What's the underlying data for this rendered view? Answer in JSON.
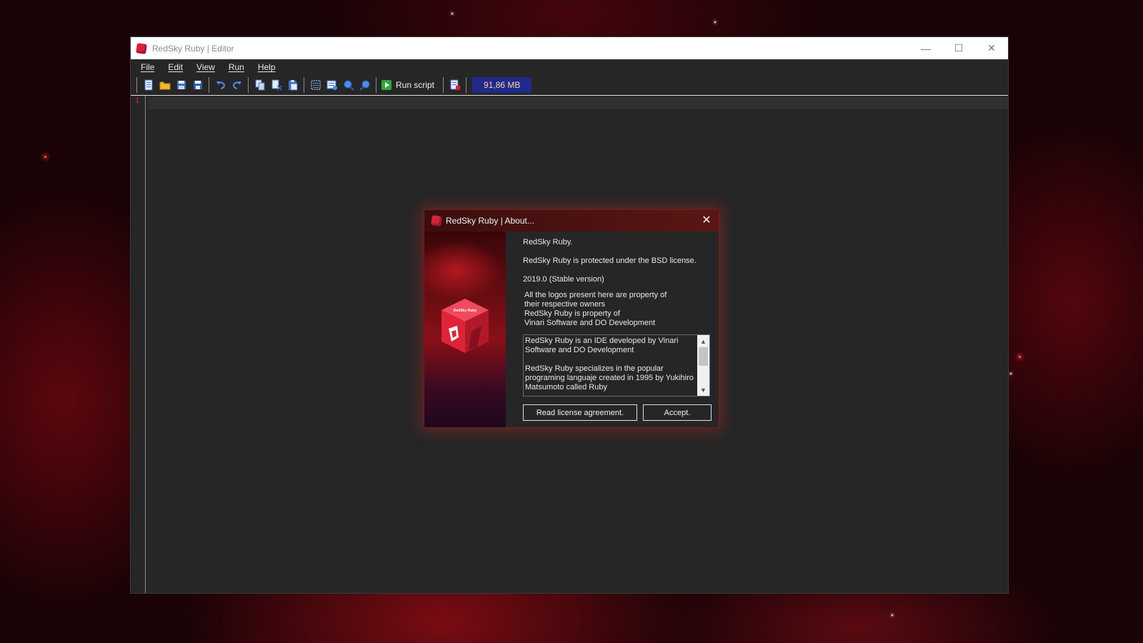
{
  "window": {
    "title": "RedSky Ruby | Editor",
    "controls": {
      "minimize": "—",
      "maximize": "☐",
      "close": "✕"
    }
  },
  "menu": {
    "items": [
      "File",
      "Edit",
      "View",
      "Run",
      "Help"
    ]
  },
  "toolbar": {
    "icons": [
      "new-file-icon",
      "open-folder-icon",
      "save-as-icon",
      "save-icon",
      "undo-icon",
      "redo-icon",
      "copy-icon",
      "cut-icon",
      "paste-icon",
      "select-all-icon",
      "find-icon",
      "zoom-in-icon",
      "zoom-out-icon",
      "run-icon",
      "script-settings-icon"
    ],
    "run_label": "Run script",
    "memory": "91,86 MB"
  },
  "editor": {
    "line_number": "1"
  },
  "about": {
    "title": "RedSky Ruby | About...",
    "close": "✕",
    "name": "RedSky Ruby.",
    "license": "RedSky Ruby is protected under the BSD license.",
    "version": "2019.0 (Stable version)",
    "ownership": [
      "All the logos present here are property of",
      "their respective owners",
      "RedSky Ruby is property of",
      "Vinari Software and DO Development"
    ],
    "description": [
      "RedSky Ruby is an IDE developed by Vinari Software and DO Development",
      "RedSky Ruby specializes in the popular programing languaje created in 1995 by Yukihiro Matsumoto called Ruby"
    ],
    "art_label": "RedSky Ruby",
    "read_license_button": "Read license agreement.",
    "accept_button": "Accept."
  },
  "colors": {
    "accent": "#d8233a",
    "memory_bg": "#1f2a8c",
    "memory_fg": "#ffd1a0",
    "editor_bg": "#262626"
  }
}
